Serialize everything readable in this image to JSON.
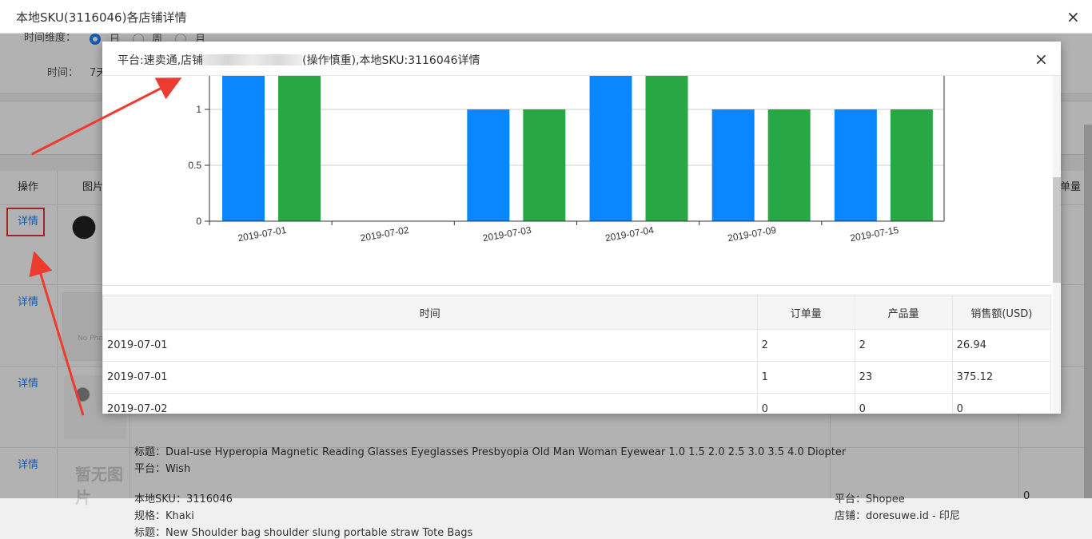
{
  "outer": {
    "title": "本地SKU(3116046)各店铺详情",
    "close": "×",
    "filter": {
      "dimension_label": "时间维度：",
      "options": [
        "日",
        "周",
        "月"
      ],
      "selected": "日",
      "time_label": "时间：",
      "time_value": "7天"
    },
    "table": {
      "headers": [
        "操作",
        "图片",
        "单量"
      ],
      "detail_label": "详情",
      "rows": [
        {
          "lines": []
        },
        {
          "lines": []
        },
        {
          "lines": [
            "标题：Dual-use Hyperopia Magnetic Reading Glasses Eyeglasses Presbyopia Old Man Woman Eyewear 1.0 1.5 2.0 2.5 3.0 3.5 4.0 Diopter",
            "平台：Wish"
          ]
        },
        {
          "lines": [
            "本地SKU：3116046",
            "规格：Khaki",
            "标题：New Shoulder bag shoulder slung portable straw Tote Bags"
          ],
          "store_lines": [
            "平台：Shopee",
            "店铺：doresuwe.id - 印尼"
          ],
          "count": "0"
        }
      ],
      "no_photo_text": "No Photo",
      "no_image_text": "暂无图片"
    }
  },
  "inner": {
    "title": "平台:速卖通,店铺",
    "title_suffix": "(操作慎重),本地SKU:3116046详情",
    "close": "×",
    "table_headers": [
      "时间",
      "订单量",
      "产品量",
      "销售额(USD)"
    ],
    "table_rows": [
      [
        "2019-07-01",
        "2",
        "2",
        "26.94"
      ],
      [
        "2019-07-01",
        "1",
        "23",
        "375.12"
      ],
      [
        "2019-07-02",
        "0",
        "0",
        "0"
      ]
    ]
  },
  "chart_data": {
    "type": "bar",
    "categories": [
      "2019-07-01",
      "2019-07-02",
      "2019-07-03",
      "2019-07-04",
      "2019-07-09",
      "2019-07-15"
    ],
    "series": [
      {
        "values": [
          2,
          0,
          1,
          2,
          1,
          1
        ],
        "color": "#0a86ff"
      },
      {
        "values": [
          2,
          0,
          1,
          2,
          1,
          1
        ],
        "color": "#27a844"
      }
    ],
    "yticks": [
      "0",
      "0.5",
      "1"
    ],
    "ylim": [
      0,
      2
    ],
    "grid": true
  }
}
